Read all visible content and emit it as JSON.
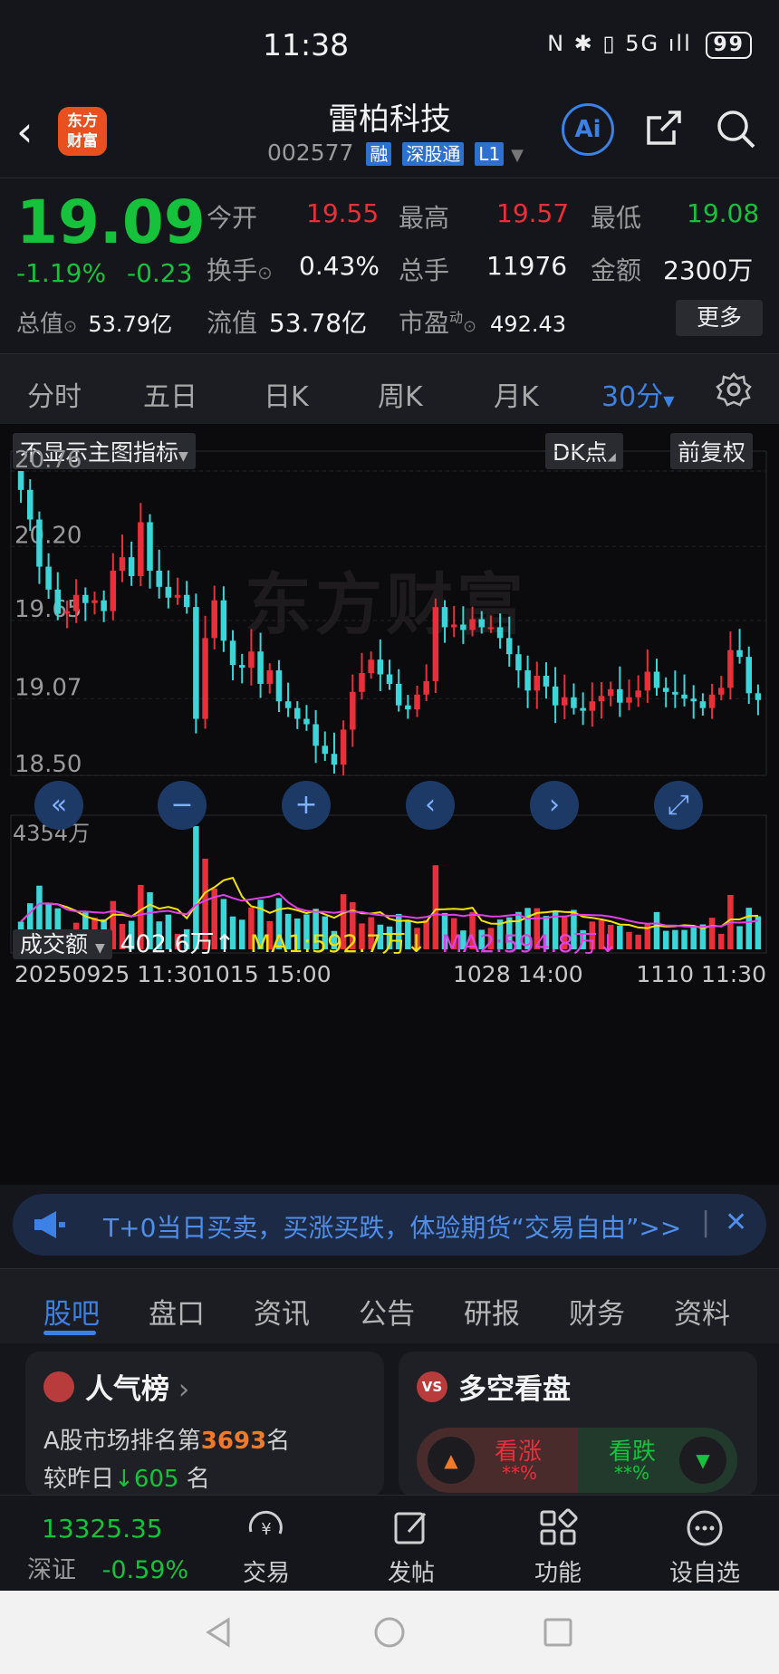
{
  "status_bar": {
    "time": "11:38",
    "signal": "N ✱ ▯ 5G ıll",
    "battery": "99"
  },
  "header": {
    "logo_text": "东方\n财富",
    "stock_name": "雷柏科技",
    "stock_code": "002577",
    "tags": [
      "融",
      "深股通",
      "L1"
    ],
    "ai_label": "Ai"
  },
  "quote": {
    "price": "19.09",
    "change_pct": "-1.19%",
    "change": "-0.23",
    "open_label": "今开",
    "open": "19.55",
    "high_label": "最高",
    "high": "19.57",
    "low_label": "最低",
    "low": "19.08",
    "turnover_label": "换手",
    "turnover": "0.43%",
    "volume_label": "总手",
    "volume": "11976",
    "amount_label": "金额",
    "amount": "2300万",
    "mktcap_label": "总值",
    "mktcap": "53.79亿",
    "float_label": "流值",
    "float_cap": "53.78亿",
    "pe_label": "市盈",
    "pe_sup": "动",
    "pe": "492.43",
    "more_label": "更多"
  },
  "periods": {
    "items": [
      "分时",
      "五日",
      "日K",
      "周K",
      "月K",
      "30分"
    ],
    "active": "30分"
  },
  "chart_controls": {
    "indicator_select": "不显示主图指标",
    "dk_label": "DK点",
    "adjust_label": "前复权",
    "watermark": "东方财富"
  },
  "chart_data": [
    {
      "type": "candlestick",
      "title": "",
      "y_ticks": [
        "20.76",
        "20.20",
        "19.65",
        "19.07",
        "18.50"
      ],
      "ylim": [
        18.5,
        20.76
      ],
      "closes": [
        20.62,
        20.4,
        20.05,
        19.88,
        19.7,
        19.72,
        19.84,
        19.78,
        19.8,
        19.72,
        20.02,
        20.12,
        19.98,
        20.38,
        20.02,
        19.9,
        19.82,
        19.84,
        19.75,
        18.92,
        19.52,
        19.8,
        19.5,
        19.32,
        19.3,
        19.42,
        19.18,
        19.28,
        19.05,
        19.0,
        18.92,
        18.88,
        18.72,
        18.66,
        18.58,
        18.84,
        19.12,
        19.26,
        19.36,
        19.25,
        19.18,
        19.02,
        18.99,
        19.1,
        19.2,
        19.75,
        19.6,
        19.62,
        19.58,
        19.66,
        19.6,
        19.6,
        19.52,
        19.4,
        19.28,
        19.13,
        19.24,
        19.16,
        19.02,
        19.08,
        19.0,
        18.98,
        19.05,
        19.09,
        19.14,
        19.04,
        19.08,
        19.13,
        19.27,
        19.15,
        19.12,
        19.1,
        19.07,
        19.05,
        19.0,
        19.1,
        19.15,
        19.43,
        19.38,
        19.11,
        19.06
      ],
      "volume": {
        "label": "成交额",
        "value": "402.6万",
        "ma1": "MA1:592.7万",
        "ma2": "MA2:594.8万",
        "max_tick": "4354万"
      },
      "x_ticks": [
        "20250925 11:30",
        "1015 15:00",
        "1028 14:00",
        "1110 11:30"
      ],
      "colors": {
        "up": "#e8303a",
        "down": "#3cd6d9",
        "ma1": "#f4e300",
        "ma2": "#e040e8"
      }
    }
  ],
  "chart_nav": [
    "«",
    "−",
    "+",
    "‹",
    "›",
    "⤢"
  ],
  "banner": {
    "text": "T+0当日买卖，买涨买跌，体验期货“交易自由”>>",
    "close": "✕"
  },
  "tabs": {
    "items": [
      "股吧",
      "盘口",
      "资讯",
      "公告",
      "研报",
      "财务",
      "资料"
    ],
    "active": "股吧"
  },
  "popularity": {
    "title": "人气榜",
    "rank_prefix": "A股市场排名第",
    "rank": "3693",
    "rank_suffix": "名",
    "change_prefix": "较昨日",
    "change_value": "605",
    "change_suffix": "名"
  },
  "sentiment": {
    "title": "多空看盘",
    "bull_label": "看涨",
    "bull_pct": "**%",
    "bear_label": "看跌",
    "bear_pct": "**%"
  },
  "dock": {
    "index_value": "13325.35",
    "index_name": "深证",
    "index_change": "-0.59%",
    "items": [
      "交易",
      "发帖",
      "功能",
      "设自选"
    ]
  }
}
